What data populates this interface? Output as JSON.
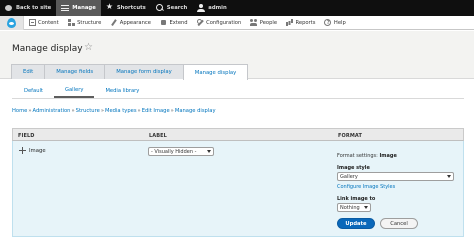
{
  "toolbar": {
    "back": "Back to site",
    "manage": "Manage",
    "shortcuts": "Shortcuts",
    "search": "Search",
    "user": "admin"
  },
  "tray": {
    "items": [
      "Content",
      "Structure",
      "Appearance",
      "Extend",
      "Configuration",
      "People",
      "Reports",
      "Help"
    ]
  },
  "page": {
    "title": "Manage display",
    "tabs": [
      "Edit",
      "Manage fields",
      "Manage form display",
      "Manage display"
    ],
    "active_tab": "Manage display",
    "subtabs": [
      "Default",
      "Gallery",
      "Media library"
    ],
    "active_subtab": "Gallery",
    "breadcrumb": [
      "Home",
      "Administration",
      "Structure",
      "Media types",
      "Edit Image",
      "Manage display"
    ]
  },
  "table": {
    "headers": {
      "field": "FIELD",
      "label": "LABEL",
      "format": "FORMAT"
    },
    "row": {
      "field": "Image",
      "label_value": "- Visually Hidden -",
      "settings_prefix": "Format settings:",
      "settings_value": "Image",
      "image_style_label": "Image style",
      "image_style_value": "Gallery",
      "configure_link": "Configure Image Styles",
      "link_label": "Link image to",
      "link_value": "Nothing"
    }
  },
  "buttons": {
    "update": "Update",
    "cancel": "Cancel"
  },
  "colors": {
    "link": "#0074bd",
    "primary": "#0a68ba",
    "row_highlight": "#e7f4f9"
  }
}
